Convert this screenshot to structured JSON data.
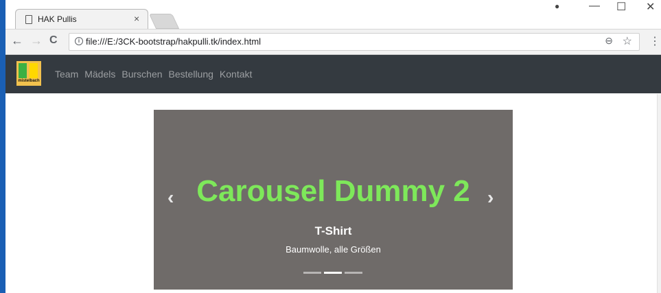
{
  "browser": {
    "tab_title": "HAK Pullis",
    "tab_close": "×",
    "url": "file:///E:/3CK-bootstrap/hakpulli.tk/index.html",
    "back": "←",
    "forward": "→",
    "reload": "C",
    "zoom": "⊖",
    "star": "☆",
    "menu": "⋮",
    "window_controls": {
      "account": "●",
      "minimize": "—",
      "maximize": "☐",
      "close": "✕"
    }
  },
  "site": {
    "logo_text": "mistelbach",
    "nav": [
      "Team",
      "Mädels",
      "Burschen",
      "Bestellung",
      "Kontakt"
    ]
  },
  "carousel": {
    "slide_title": "Carousel Dummy 2",
    "caption_title": "T-Shirt",
    "caption_text": "Baumwolle, alle Größen",
    "prev": "‹",
    "next": "›",
    "active_index": 1,
    "slide_count": 3
  },
  "colors": {
    "navbar_bg": "#343a40",
    "carousel_bg": "#6f6b69",
    "slide_title": "#7ee85a"
  }
}
